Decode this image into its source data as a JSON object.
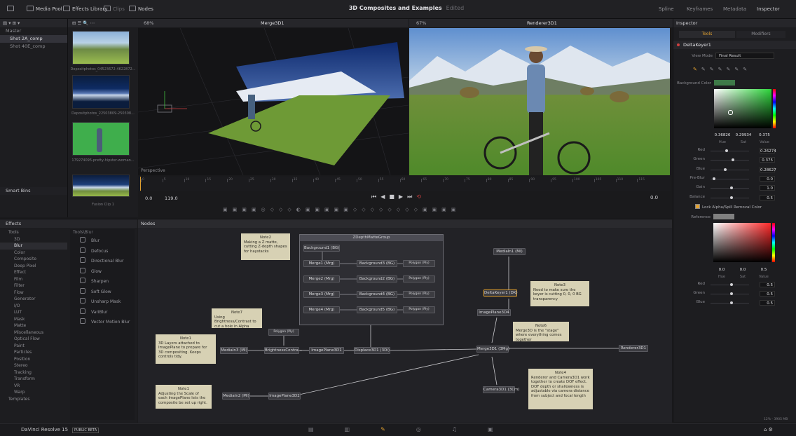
{
  "topbar": {
    "media_pool": "Media Pool",
    "effects_library": "Effects Library",
    "clips": "Clips",
    "nodes": "Nodes",
    "project_title": "3D Composites and Examples",
    "edited": "Edited",
    "spline": "Spline",
    "keyframes": "Keyframes",
    "metadata": "Metadata",
    "inspector": "Inspector"
  },
  "media_pool": {
    "bins": [
      "Master",
      "Shot 2A_comp",
      "Shot 40E_comp"
    ],
    "smart_bins": "Smart Bins",
    "clips": [
      {
        "label": "Depositphotos_04523672-4622872..."
      },
      {
        "label": "Depositphotos_22503809-250308..."
      },
      {
        "label": "179274095-pretty-hipster-woman..."
      },
      {
        "label": "Fusion Clip 1"
      }
    ]
  },
  "viewer_left": {
    "zoom": "68%",
    "title": "Merge3D1",
    "perspective": "Perspective"
  },
  "viewer_right": {
    "zoom": "67%",
    "title": "Renderer3D1"
  },
  "timeline": {
    "start": "0.0",
    "end": "119.0",
    "current": "0.0",
    "ticks": [
      "0",
      "5",
      "10",
      "15",
      "20",
      "25",
      "30",
      "35",
      "40",
      "45",
      "50",
      "55",
      "60",
      "65",
      "70",
      "75",
      "80",
      "85",
      "90",
      "95",
      "100",
      "105",
      "110",
      "115"
    ]
  },
  "effects": {
    "title": "Effects",
    "categories": [
      "Tools",
      "3D",
      "Blur",
      "Color",
      "Composite",
      "Deep Pixel",
      "Effect",
      "Film",
      "Filter",
      "Flow",
      "Generator",
      "I/O",
      "LUT",
      "Mask",
      "Matte",
      "Miscellaneous",
      "Optical Flow",
      "Paint",
      "Particles",
      "Position",
      "Stereo",
      "Tracking",
      "Transform",
      "VR",
      "Warp",
      "Templates"
    ],
    "tools_header": "Tools\\Blur",
    "tools": [
      "Blur",
      "Defocus",
      "Directional Blur",
      "Glow",
      "Sharpen",
      "Soft Glow",
      "Unsharp Mask",
      "VariBlur",
      "Vector Motion Blur"
    ]
  },
  "nodes": {
    "title": "Nodes",
    "group_title": "ZDepthMatteGroup",
    "items": {
      "bg1": "Background1 (BG)",
      "merge1": "Merge1 (Mrg)",
      "merge2": "Merge2 (Mrg)",
      "merge3": "Merge3 (Mrg)",
      "merge4": "Merge4 (Mrg)",
      "bg2": "Background2 (BG)",
      "bg3": "Background3 (BG)",
      "bg4": "Background4 (BG)",
      "bg5": "Background5 (BG)",
      "polygon": "Polygon (Ply)",
      "mediain1": "MediaIn1 (MI)",
      "deltakeyer": "DeltaKeyer1 (DK)",
      "imageplane3d4": "ImagePlane3D4",
      "mediain3": "MediaIn3 (MI)",
      "brightness": "BrightnessContra...",
      "imageplane3d1": "ImagePlane3D1",
      "displace": "Displace3D1 (3Di)",
      "merge3d": "Merge3D1 (3Mg)",
      "renderer": "Renderer3D1",
      "mediain2": "MediaIn2 (MI)",
      "imageplane3d2": "ImagePlane3D2",
      "camera": "Camera3D1 (3Cm)",
      "polygon2": "Polygon (Ply)"
    },
    "notes": {
      "note1": {
        "title": "Note1",
        "text": "3D Layers attached to ImagePlane to prepare for 3D compositing. Keeps controls tidy."
      },
      "note2": {
        "title": "Note2",
        "text": "Making a Z matte, cutting Z-depth shapes for haystacks"
      },
      "note3": {
        "title": "Note3",
        "text": "Need to make sure the keyer is cutting 0, 0, 0 BG transparency"
      },
      "note4": {
        "title": "Note4",
        "text": "Renderer and Camera3D1 work together to create DOF effect. DOF depth or shallowness is adjustable via camera distance from subject and focal length"
      },
      "note6": {
        "title": "Note6",
        "text": "Merge3D is the \"stage\" where everything comes together"
      },
      "note7": {
        "title": "Note7",
        "text": "Using Brightness/Contrast to cut a hole in Alpha"
      },
      "note8": {
        "title": "Note1",
        "text": "Adjusting the Scale of each ImagePlane lets the composite be set up right."
      }
    }
  },
  "inspector": {
    "title": "Inspector",
    "tab_tools": "Tools",
    "tab_modifiers": "Modifiers",
    "node_name": "DeltaKeyer1",
    "view_mode_label": "View Mode",
    "view_mode_value": "Final Result",
    "background_color": "Background Color",
    "hsv_values": [
      "0.36826",
      "0.29934",
      "0.375"
    ],
    "hsv_labels": [
      "Hue",
      "Sat",
      "Value"
    ],
    "rows": [
      {
        "label": "Red",
        "value": "0.26274"
      },
      {
        "label": "Green",
        "value": "0.375"
      },
      {
        "label": "Blue",
        "value": "0.28627"
      },
      {
        "label": "Pre-Blur",
        "value": "0.0"
      },
      {
        "label": "Gain",
        "value": "1.0"
      },
      {
        "label": "Balance",
        "value": "0.5"
      }
    ],
    "lock_label": "Lock Alpha/Spill Removal Color",
    "reference": "Reference",
    "ref_values": [
      "0.0",
      "0.0",
      "0.5"
    ],
    "ref_labels": [
      "Hue",
      "Sat",
      "Value"
    ],
    "ref_rows": [
      {
        "label": "Red",
        "value": "0.5"
      },
      {
        "label": "Green",
        "value": "0.5"
      },
      {
        "label": "Blue",
        "value": "0.5"
      }
    ]
  },
  "status": {
    "app_name": "DaVinci Resolve 15",
    "badge": "PUBLIC BETA",
    "mem": "12% - 3905 MB"
  },
  "colors": {
    "accent": "#e0a030",
    "background_swatch": "#3e7a48",
    "reference_swatch": "#808080"
  }
}
